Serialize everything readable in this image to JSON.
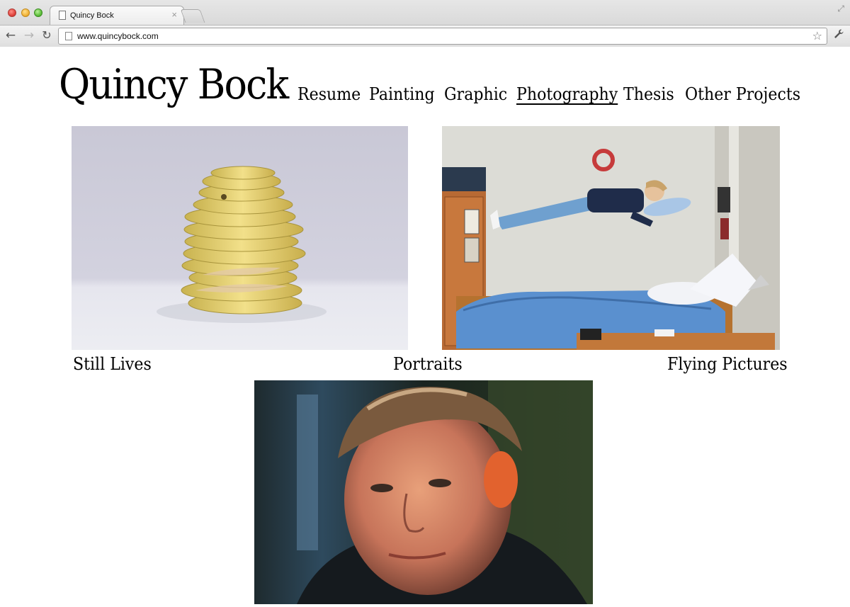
{
  "browser": {
    "tab_title": "Quincy Bock",
    "tab_close": "×",
    "url": "www.quincybock.com",
    "back_glyph": "←",
    "forward_glyph": "→",
    "reload_glyph": "↻",
    "star_glyph": "☆",
    "wrench_glyph": "🔧"
  },
  "site": {
    "title": "Quincy Bock",
    "nav": [
      {
        "label": "Resume"
      },
      {
        "label": "Painting"
      },
      {
        "label": "Graphic"
      },
      {
        "label": "Photography",
        "active": true
      },
      {
        "label": "Thesis"
      },
      {
        "label": "Other Projects"
      }
    ]
  },
  "gallery": {
    "captions": [
      "Still Lives",
      "Portraits",
      "Flying Pictures"
    ],
    "images": [
      {
        "subject": "stack of sliced apple rings on white",
        "icon": "still-life-photo"
      },
      {
        "subject": "person levitating over a dorm bed",
        "icon": "flying-photo"
      },
      {
        "subject": "close-up portrait of a young man",
        "icon": "portrait-photo"
      }
    ]
  },
  "colors": {
    "text": "#000000",
    "background": "#ffffff"
  }
}
